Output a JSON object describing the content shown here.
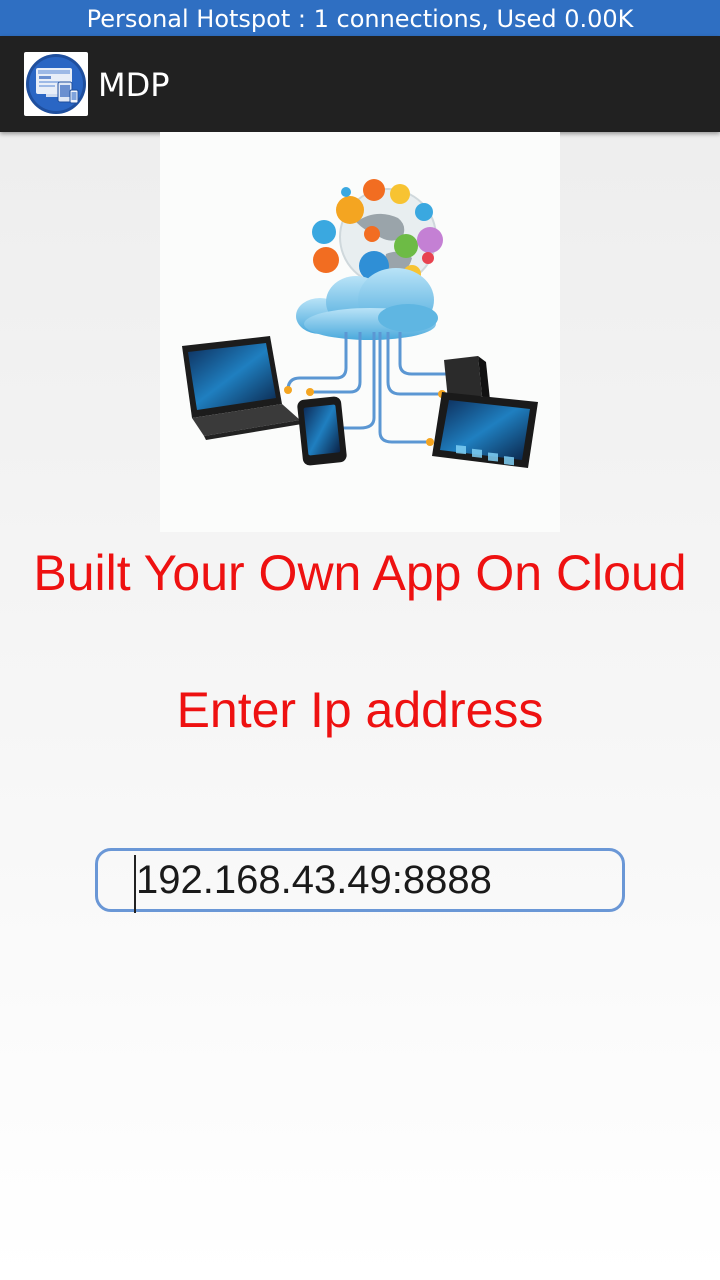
{
  "status_bar": {
    "text": "Personal Hotspot : 1 connections, Used 0.00K"
  },
  "app_bar": {
    "title": "MDP",
    "logo_icon": "responsive-devices-logo-icon"
  },
  "hero": {
    "icon": "cloud-devices-illustration-icon"
  },
  "main": {
    "headline": "Built Your Own App On Cloud",
    "prompt": "Enter Ip address",
    "ip_field": {
      "value": "192.168.43.49:8888",
      "placeholder": ""
    }
  },
  "colors": {
    "status_bar": "#2f6fc2",
    "app_bar": "#212121",
    "headline_text": "#ee1111",
    "input_border": "#6a97d6"
  }
}
